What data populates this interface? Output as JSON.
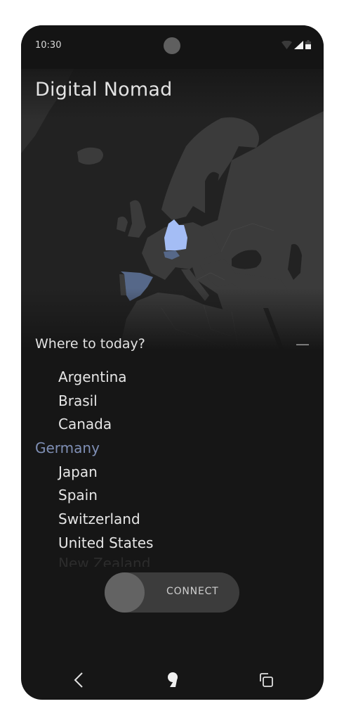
{
  "status_bar": {
    "time": "10:30",
    "icons": [
      "wifi-icon",
      "signal-icon",
      "battery-icon"
    ]
  },
  "app": {
    "title": "Digital Nomad"
  },
  "map": {
    "highlighted_countries": [
      {
        "name": "Germany",
        "state": "selected",
        "color": "#a4bdf5"
      },
      {
        "name": "Spain",
        "state": "available",
        "color": "#566889"
      },
      {
        "name": "Switzerland",
        "state": "available",
        "color": "#566889"
      }
    ],
    "land_color": "#3b3b3b",
    "water_color": "#222222"
  },
  "destinations": {
    "heading": "Where to today?",
    "collapse_symbol": "—",
    "items": [
      {
        "label": "Argentina",
        "selected": false
      },
      {
        "label": "Brasil",
        "selected": false
      },
      {
        "label": "Canada",
        "selected": false
      },
      {
        "label": "Germany",
        "selected": true
      },
      {
        "label": "Japan",
        "selected": false
      },
      {
        "label": "Spain",
        "selected": false
      },
      {
        "label": "Switzerland",
        "selected": false
      },
      {
        "label": "United States",
        "selected": false
      },
      {
        "label": "New Zealand",
        "selected": false
      }
    ],
    "selected_color": "#7f8fb5"
  },
  "connect_toggle": {
    "label": "CONNECT",
    "on": false
  },
  "nav_bar": {
    "buttons": [
      "back-icon",
      "home-icon",
      "recents-icon"
    ]
  }
}
